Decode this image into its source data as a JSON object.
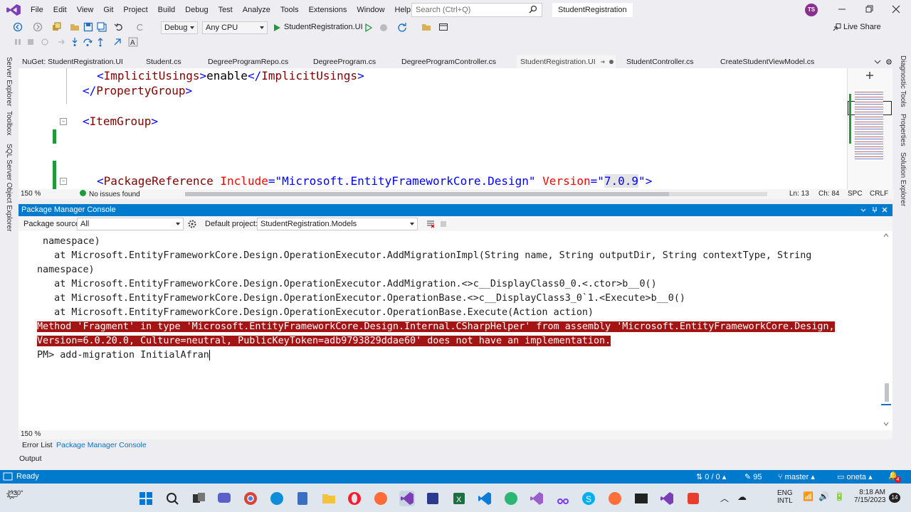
{
  "menu": {
    "items": [
      "File",
      "Edit",
      "View",
      "Git",
      "Project",
      "Build",
      "Debug",
      "Test",
      "Analyze",
      "Tools",
      "Extensions",
      "Window",
      "Help"
    ],
    "search_placeholder": "Search (Ctrl+Q)",
    "solution_name": "StudentRegistration",
    "user_initials": "TS"
  },
  "toolbar": {
    "config": "Debug",
    "platform": "Any CPU",
    "startup_project": "StudentRegistration.UI",
    "live_share": "Live Share"
  },
  "side_panels": {
    "left": [
      "Server Explorer",
      "Toolbox",
      "SQL Server Object Explorer"
    ],
    "right": [
      "Diagnostic Tools",
      "Properties",
      "Solution Explorer"
    ]
  },
  "doc_tabs": [
    "NuGet: StudentRegistration.UI",
    "Student.cs",
    "DegreeProgramRepo.cs",
    "DegreeProgram.cs",
    "DegreeProgramController.cs",
    "StudentRegistration.UI",
    "StudentController.cs",
    "CreateStudentViewModel.cs"
  ],
  "editor": {
    "line1": {
      "open": "<",
      "tag": "ImplicitUsings",
      "close": ">",
      "text": "enable",
      "end_open": "</",
      "end_tag": "ImplicitUsings",
      "end_close": ">"
    },
    "line2": {
      "open": "</",
      "tag": "PropertyGroup",
      "close": ">"
    },
    "line3": {
      "open": "<",
      "tag": "ItemGroup",
      "close": ">"
    },
    "line4": {
      "open": "<",
      "tag": "PackageReference",
      "attr1": "Include",
      "eq": "=\"",
      "val1": "Microsoft.EntityFrameworkCore.Design",
      "q": "\"",
      "attr2": "Version",
      "val2": "7.0.9",
      "close": ">"
    }
  },
  "editor_status": {
    "zoom": "150 %",
    "issues": "No issues found",
    "line": "Ln: 13",
    "char": "Ch: 84",
    "spc": "SPC",
    "crlf": "CRLF"
  },
  "pmc": {
    "title": "Package Manager Console",
    "source_label": "Package source:",
    "source_value": "All",
    "default_project_label": "Default project:",
    "default_project_value": "StudentRegistration.Models",
    "lines": [
      " namespace)",
      "   at Microsoft.EntityFrameworkCore.Design.OperationExecutor.AddMigrationImpl(String name, String outputDir, String contextType, String",
      "namespace)",
      "   at Microsoft.EntityFrameworkCore.Design.OperationExecutor.AddMigration.<>c__DisplayClass0_0.<.ctor>b__0()",
      "   at Microsoft.EntityFrameworkCore.Design.OperationExecutor.OperationBase.<>c__DisplayClass3_0`1.<Execute>b__0()",
      "   at Microsoft.EntityFrameworkCore.Design.OperationExecutor.OperationBase.Execute(Action action)"
    ],
    "error_lines": [
      "Method 'Fragment' in type 'Microsoft.EntityFrameworkCore.Design.Internal.CSharpHelper' from assembly 'Microsoft.EntityFrameworkCore.Design,",
      "Version=6.0.20.0, Culture=neutral, PublicKeyToken=adb9793829ddae60' does not have an implementation."
    ],
    "prompt": "PM> ",
    "command": "add-migration InitialAfran",
    "zoom": "150 %"
  },
  "bottom_tabs": [
    "Error List",
    "Package Manager Console"
  ],
  "output_tab": "Output",
  "statusbar": {
    "ready": "Ready",
    "changes": "0 / 0",
    "commits": "95",
    "branch": "master",
    "repo": "oneta",
    "notifications": "4"
  },
  "taskbar": {
    "weather": "30°",
    "lang1": "ENG",
    "lang2": "INTL",
    "time": "8:18 AM",
    "date": "7/15/2023",
    "notif_count": "14"
  }
}
